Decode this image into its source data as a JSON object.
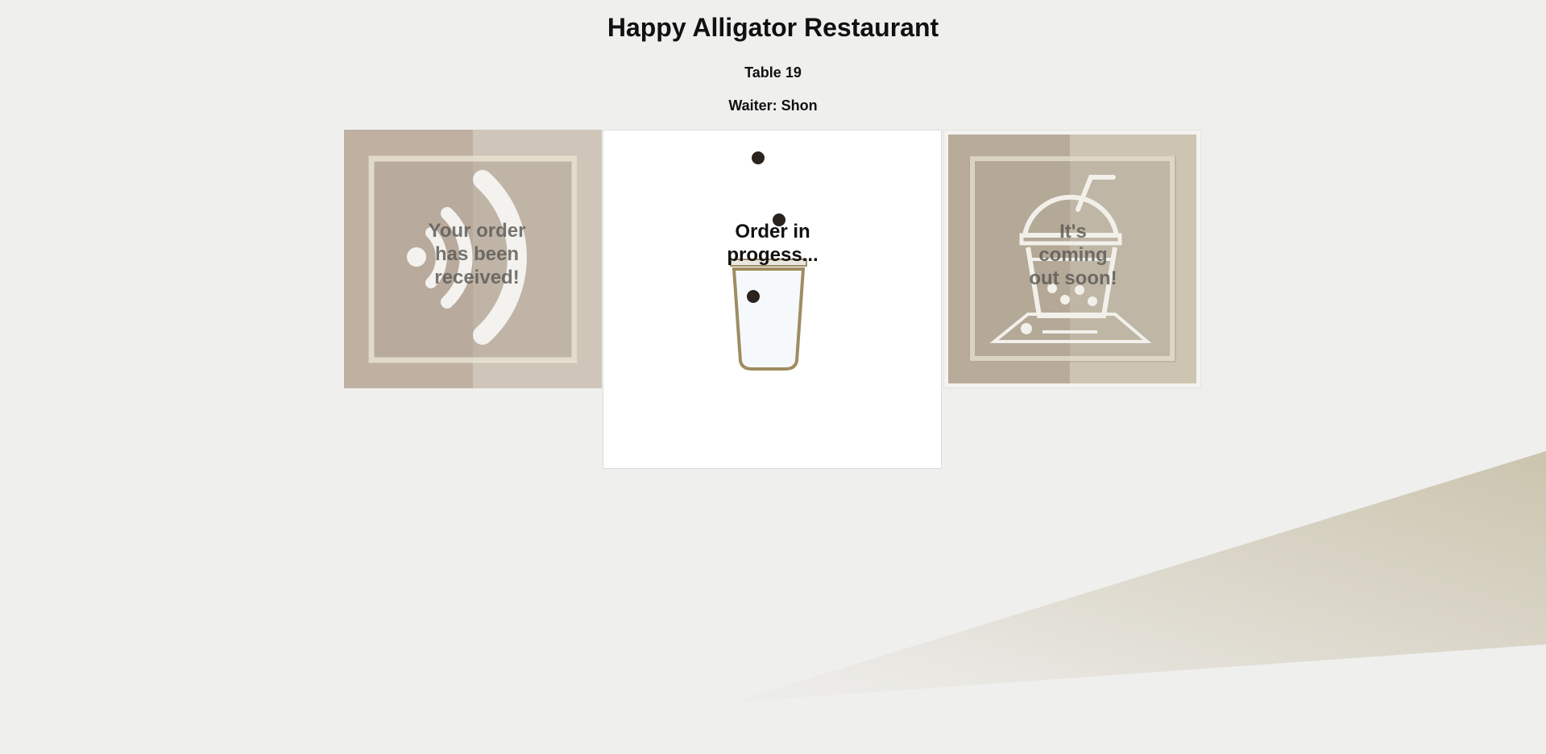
{
  "header": {
    "title": "Happy Alligator Restaurant",
    "table": "Table 19",
    "waiter": "Waiter: Shon"
  },
  "steps": [
    {
      "label": "Your order has been received!",
      "icon": "wifi-signal-icon",
      "state": "completed"
    },
    {
      "label": "Order in progess...",
      "icon": "cup-filling-icon",
      "state": "active"
    },
    {
      "label": "It's coming out soon!",
      "icon": "drink-with-straw-icon",
      "state": "upcoming"
    }
  ],
  "colors": {
    "background": "#efefed",
    "card_tan": "#c2b4a6",
    "cup_outline": "#a08c62",
    "dots": "#2b231d",
    "floor_shade": "#cbc3ad"
  }
}
